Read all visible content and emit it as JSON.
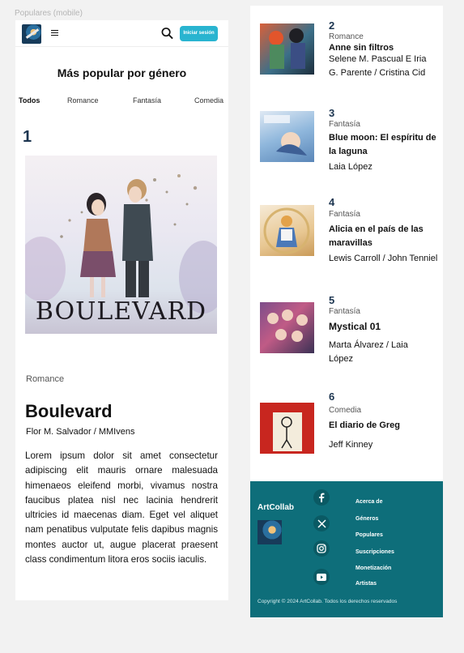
{
  "frame_label": "Populares (mobile)",
  "header": {
    "login_label": "Iniciar sesión"
  },
  "page_title": "Más popular por género",
  "tabs": [
    {
      "label": "Todos"
    },
    {
      "label": "Romance"
    },
    {
      "label": "Fantasía"
    },
    {
      "label": "Comedia"
    }
  ],
  "featured": {
    "rank": "1",
    "cover_text": "BOULEVARD",
    "genre": "Romance",
    "title": "Boulevard",
    "author": "Flor M. Salvador / MMIvens",
    "description": "Lorem ipsum dolor sit amet consectetur adipiscing elit mauris ornare malesuada himenaeos eleifend morbi, vivamus nostra faucibus platea nisl nec lacinia hendrerit ultricies id maecenas diam. Eget vel aliquet nam penatibus vulputate felis dapibus magnis montes auctor ut, augue placerat praesent class condimentum litora eros sociis iaculis."
  },
  "items": [
    {
      "rank": "2",
      "genre": "Romance",
      "title": "Anne sin filtros",
      "author": "Selene M. Pascual E Iria G. Parente / Cristina Cid"
    },
    {
      "rank": "3",
      "genre": "Fantasía",
      "title": "Blue moon: El espíritu de la laguna",
      "author": "Laia López"
    },
    {
      "rank": "4",
      "genre": "Fantasía",
      "title": "Alicia en el país de las maravillas",
      "author": "Lewis Carroll / John Tenniel"
    },
    {
      "rank": "5",
      "genre": "Fantasía",
      "title": "Mystical 01",
      "author": "Marta Álvarez / Laia López"
    },
    {
      "rank": "6",
      "genre": "Comedia",
      "title": "El diario de Greg",
      "author": "Jeff Kinney"
    }
  ],
  "footer": {
    "brand": "ArtCollab",
    "links": [
      "Acerca de",
      "Géneros",
      "Populares",
      "Suscripciones",
      "Monetización",
      "Artistas"
    ],
    "social_icons": [
      "facebook-icon",
      "x-icon",
      "instagram-icon",
      "youtube-icon"
    ],
    "copyright": "Copyright © 2024 ArtCollab.  Todos los derechos reservados"
  },
  "colors": {
    "accent": "#29b4d0",
    "footer_bg": "#0e6e7a",
    "rank": "#1c3550"
  }
}
